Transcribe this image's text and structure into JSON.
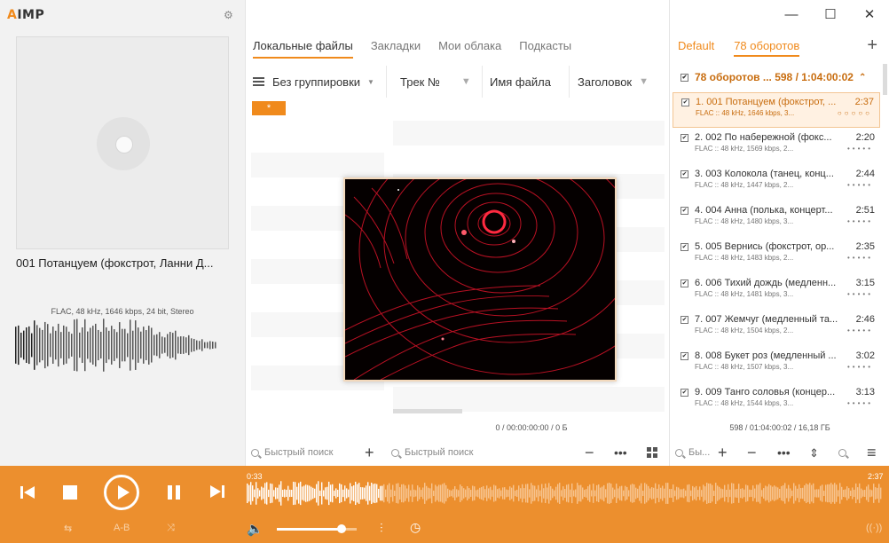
{
  "app": {
    "logo_prefix": "A",
    "logo_rest": "IMP"
  },
  "now_playing": {
    "title": "001 Потанцуем (фокстрот, Ланни Д...",
    "format": "FLAC, 48 kHz, 1646 kbps, 24 bit, Stereo"
  },
  "library": {
    "tabs": [
      {
        "label": "Локальные файлы",
        "active": true
      },
      {
        "label": "Закладки",
        "active": false
      },
      {
        "label": "Мои облака",
        "active": false
      },
      {
        "label": "Подкасты",
        "active": false
      }
    ],
    "grouping_label": "Без группировки",
    "columns": [
      "Трек №",
      "Имя файла",
      "Заголовок"
    ],
    "star_tag": "*",
    "status": "0 / 00:00:00:00 / 0 Б",
    "search_placeholder_left": "Быстрый поиск",
    "search_placeholder_right": "Быстрый поиск"
  },
  "playlist": {
    "tabs": [
      {
        "label": "Default",
        "active": false
      },
      {
        "label": "78 оборотов",
        "active": true
      }
    ],
    "group_header": "78 оборотов ... 598 / 1:04:00:02",
    "items": [
      {
        "title": "1. 001 Потанцуем (фокстрот, ...",
        "duration": "2:37",
        "meta": "FLAC :: 48 kHz, 1646 kbps, 3...",
        "rating_dots": "○○○○○",
        "active": true
      },
      {
        "title": "2. 002 По набережной (фокс...",
        "duration": "2:20",
        "meta": "FLAC :: 48 kHz, 1569 kbps, 2...",
        "rating_dots": "•••••",
        "active": false
      },
      {
        "title": "3. 003 Колокола (танец, конц...",
        "duration": "2:44",
        "meta": "FLAC :: 48 kHz, 1447 kbps, 2...",
        "rating_dots": "•••••",
        "active": false
      },
      {
        "title": "4. 004 Анна (полька, концерт...",
        "duration": "2:51",
        "meta": "FLAC :: 48 kHz, 1480 kbps, 3...",
        "rating_dots": "•••••",
        "active": false
      },
      {
        "title": "5. 005 Вернись (фокстрот, ор...",
        "duration": "2:35",
        "meta": "FLAC :: 48 kHz, 1483 kbps, 2...",
        "rating_dots": "•••••",
        "active": false
      },
      {
        "title": "6. 006 Тихий дождь (медленн...",
        "duration": "3:15",
        "meta": "FLAC :: 48 kHz, 1481 kbps, 3...",
        "rating_dots": "•••••",
        "active": false
      },
      {
        "title": "7. 007 Жемчуг (медленный та...",
        "duration": "2:46",
        "meta": "FLAC :: 48 kHz, 1504 kbps, 2...",
        "rating_dots": "•••••",
        "active": false
      },
      {
        "title": "8. 008 Букет роз (медленный ...",
        "duration": "3:02",
        "meta": "FLAC :: 48 kHz, 1507 kbps, 3...",
        "rating_dots": "•••••",
        "active": false
      },
      {
        "title": "9. 009 Танго соловья (концер...",
        "duration": "3:13",
        "meta": "FLAC :: 48 kHz, 1544 kbps, 3...",
        "rating_dots": "•••••",
        "active": false
      }
    ],
    "status": "598 / 01:04:00:02 / 16,18 ГБ",
    "search_placeholder": "Бы..."
  },
  "player": {
    "elapsed": "0:33",
    "total": "2:37",
    "ab_label": "A-B",
    "volume_fraction": 0.78,
    "accent": "#ec8f2e"
  }
}
